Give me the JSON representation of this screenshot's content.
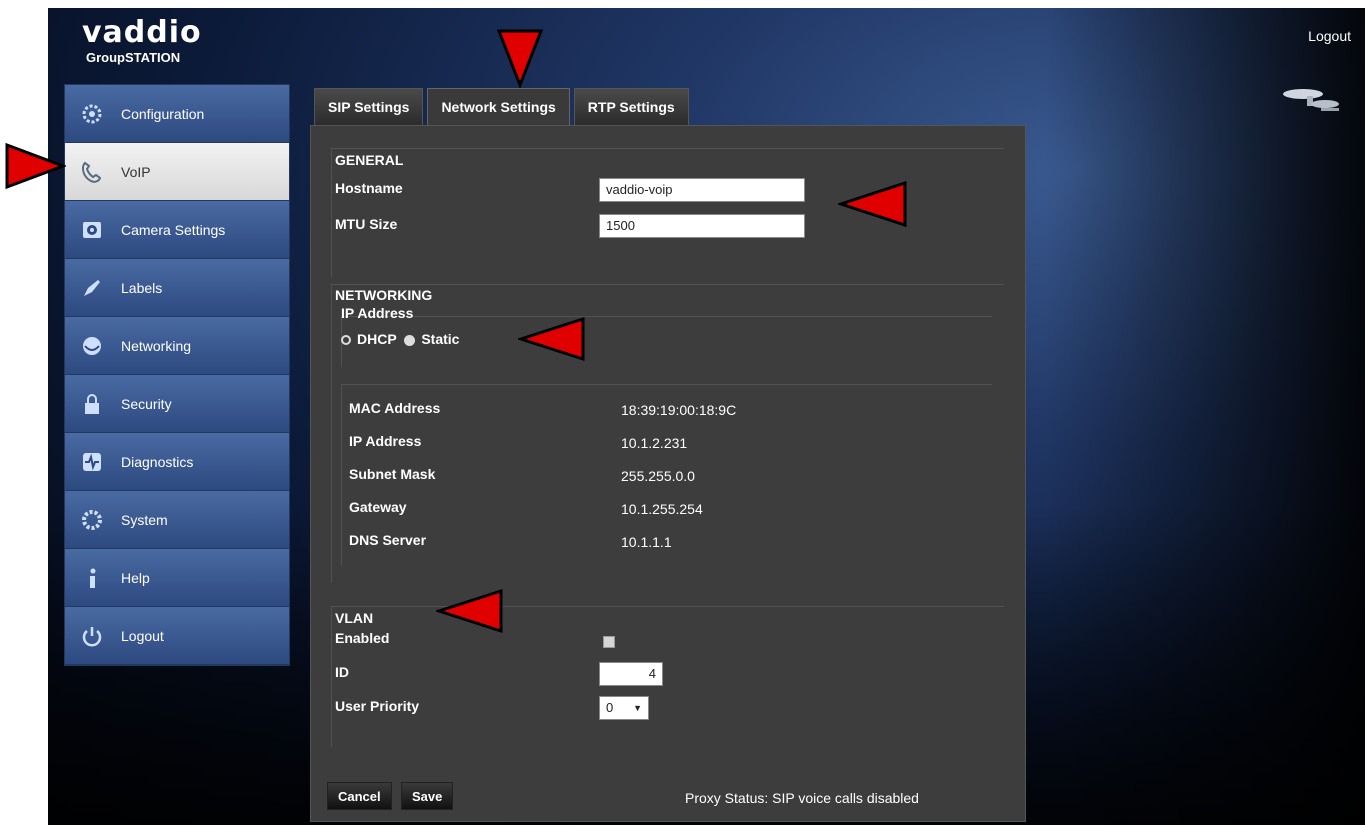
{
  "brand": {
    "name": "vaddio",
    "product": "GroupSTATION"
  },
  "header": {
    "logout_label": "Logout"
  },
  "sidebar": {
    "items": [
      {
        "label": "Configuration",
        "icon": "gear-icon"
      },
      {
        "label": "VoIP",
        "icon": "phone-icon",
        "active": true
      },
      {
        "label": "Camera Settings",
        "icon": "camera-icon"
      },
      {
        "label": "Labels",
        "icon": "pen-icon"
      },
      {
        "label": "Networking",
        "icon": "network-icon"
      },
      {
        "label": "Security",
        "icon": "lock-icon"
      },
      {
        "label": "Diagnostics",
        "icon": "diagnostics-icon"
      },
      {
        "label": "System",
        "icon": "system-gear-icon"
      },
      {
        "label": "Help",
        "icon": "info-icon"
      },
      {
        "label": "Logout",
        "icon": "power-icon"
      }
    ]
  },
  "tabs": [
    {
      "label": "SIP Settings"
    },
    {
      "label": "Network Settings",
      "active": true
    },
    {
      "label": "RTP Settings"
    }
  ],
  "general": {
    "title": "GENERAL",
    "hostname_label": "Hostname",
    "hostname_value": "vaddio-voip",
    "mtu_label": "MTU Size",
    "mtu_value": "1500"
  },
  "networking": {
    "title": "NETWORKING",
    "ip_address_title": "IP Address",
    "dhcp_label": "DHCP",
    "static_label": "Static",
    "mode_selected": "Static",
    "info": [
      {
        "label": "MAC Address",
        "value": "18:39:19:00:18:9C"
      },
      {
        "label": "IP Address",
        "value": "10.1.2.231"
      },
      {
        "label": "Subnet Mask",
        "value": "255.255.0.0"
      },
      {
        "label": "Gateway",
        "value": "10.1.255.254"
      },
      {
        "label": "DNS Server",
        "value": "10.1.1.1"
      }
    ]
  },
  "vlan": {
    "title": "VLAN",
    "enabled_label": "Enabled",
    "enabled": false,
    "id_label": "ID",
    "id_value": "4",
    "priority_label": "User Priority",
    "priority_value": "0"
  },
  "footer": {
    "cancel_label": "Cancel",
    "save_label": "Save",
    "proxy_status": "Proxy Status: SIP voice calls disabled"
  },
  "colors": {
    "callout_arrow": "#e00000",
    "sidebar_active": "#e6e6e6",
    "panel_bg": "#3d3d3d"
  }
}
